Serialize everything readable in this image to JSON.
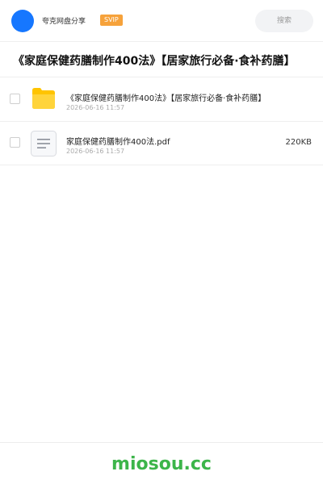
{
  "header": {
    "brand": "夸克网盘分享",
    "badge": "SVIP",
    "search_placeholder": "搜索"
  },
  "title": "《家庭保健药膳制作400法》【居家旅行必备·食补药膳】",
  "files": [
    {
      "type": "folder",
      "name": "《家庭保健药膳制作400法》【居家旅行必备·食补药膳】",
      "date": "2026-06-16 11:57",
      "size": ""
    },
    {
      "type": "document",
      "name": "家庭保健药膳制作400法.pdf",
      "date": "2026-06-16 11:57",
      "size": "220KB"
    }
  ],
  "footer": {
    "watermark": "miosou.cc"
  },
  "colors": {
    "accent": "#1677ff",
    "badge": "#f6a23b",
    "folder": "#ffc400",
    "watermark": "#3cb54a"
  }
}
